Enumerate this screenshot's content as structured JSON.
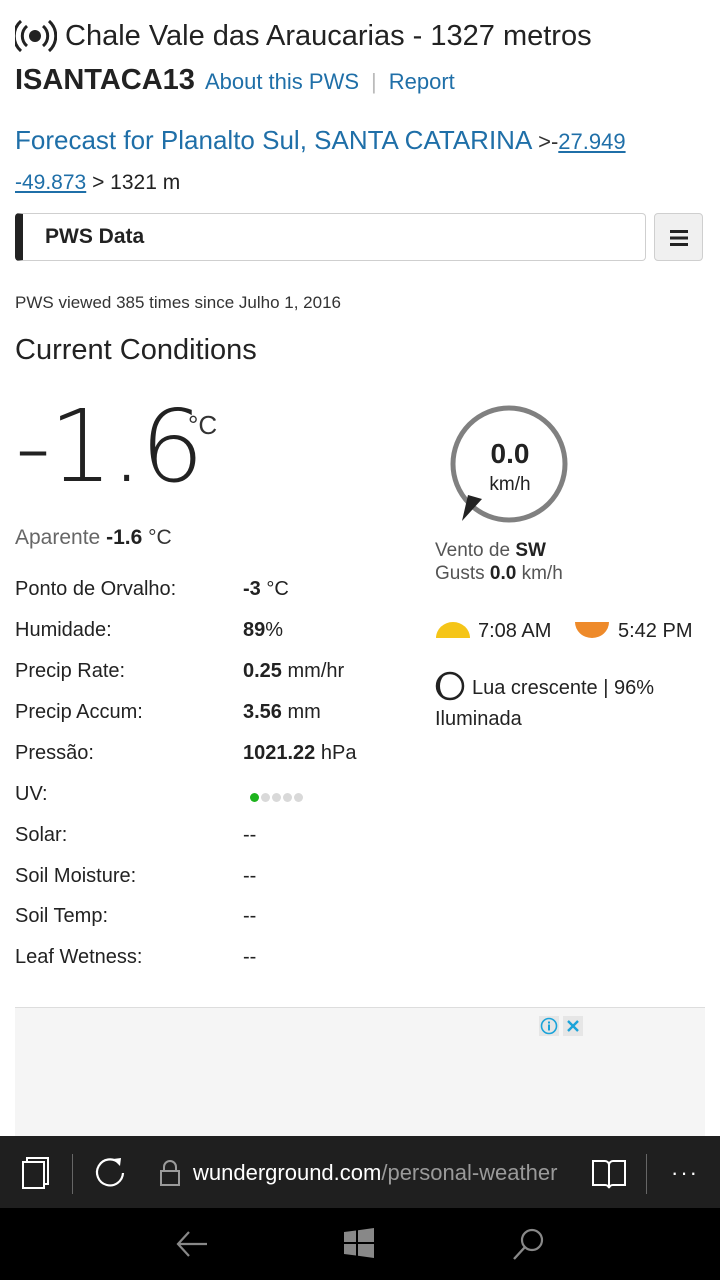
{
  "header": {
    "station_name": "Chale Vale das Araucarias - 1327 metros",
    "station_id": "ISANTACA13",
    "about_link": "About this PWS",
    "separator": "|",
    "report_link": "Report"
  },
  "forecast": {
    "link_text": "Forecast for Planalto Sul, SANTA CATARINA",
    "arrow": ">",
    "lat_prefix": "-",
    "lat": "27.949",
    "lon": "-49.873",
    "elevation": "> 1321 m"
  },
  "dropdown": {
    "label": "PWS Data"
  },
  "views_text": "PWS viewed 385 times since Julho 1, 2016",
  "section_title": "Current Conditions",
  "temperature": {
    "value": "-1.6",
    "unit": "°C",
    "feels_label": "Aparente",
    "feels_value": "-1.6",
    "feels_unit": "°C"
  },
  "conditions": [
    {
      "label": "Ponto de Orvalho:",
      "value": "-3",
      "unit": "°C"
    },
    {
      "label": "Humidade:",
      "value": "89",
      "unit": "%"
    },
    {
      "label": "Precip Rate:",
      "value": "0.25",
      "unit": "mm/hr"
    },
    {
      "label": "Precip Accum:",
      "value": "3.56",
      "unit": "mm"
    },
    {
      "label": "Pressão:",
      "value": "1021.22",
      "unit": "hPa"
    },
    {
      "label": "UV:",
      "uv_level": 1,
      "uv_max": 5
    },
    {
      "label": "Solar:",
      "value": "--",
      "unit": ""
    },
    {
      "label": "Soil Moisture:",
      "value": "--",
      "unit": ""
    },
    {
      "label": "Soil Temp:",
      "value": "--",
      "unit": ""
    },
    {
      "label": "Leaf Wetness:",
      "value": "--",
      "unit": ""
    }
  ],
  "wind": {
    "speed": "0.0",
    "unit": "km/h",
    "dir_label": "Vento de",
    "dir_value": "SW",
    "gusts_label": "Gusts",
    "gusts_value": "0.0",
    "gusts_unit": "km/h"
  },
  "astro": {
    "sunrise": "7:08 AM",
    "sunset": "5:42 PM",
    "moon_text": "Lua crescente | 96% Iluminada"
  },
  "browser": {
    "url_host": "wunderground.com",
    "url_path": "/personal-weather",
    "more_label": "···"
  },
  "colors": {
    "link": "#1f6fa8",
    "sunrise": "#f5c518",
    "sunset": "#ee8a2a",
    "uv_on": "#1db31d"
  },
  "icons": {
    "station": "broadcast-icon",
    "menu": "hamburger-icon",
    "tabs": "tabs-icon",
    "refresh": "refresh-icon",
    "lock": "lock-icon",
    "reading": "reading-view-icon",
    "back": "back-arrow-icon",
    "start": "windows-icon",
    "search": "search-icon"
  }
}
